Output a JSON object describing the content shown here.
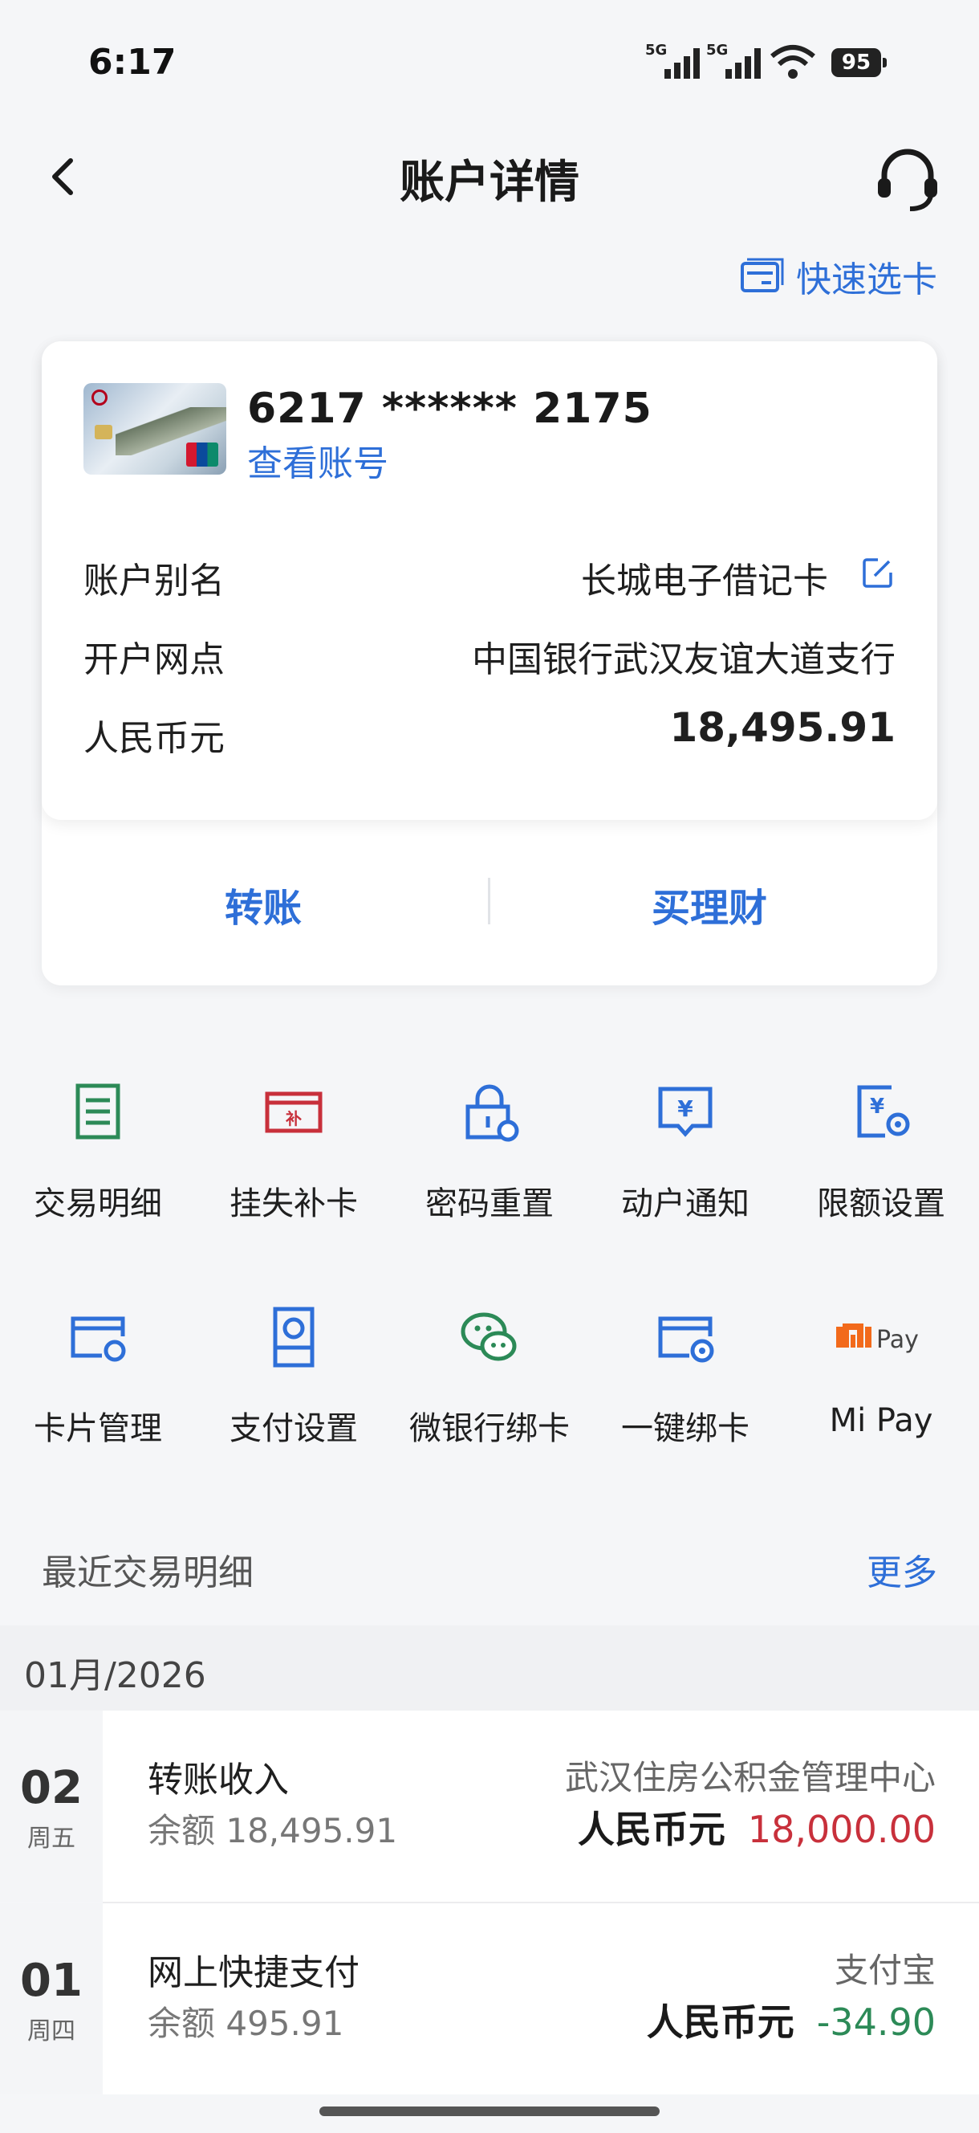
{
  "status_bar": {
    "time": "6:17",
    "battery": "95"
  },
  "header": {
    "title": "账户详情"
  },
  "quick_select": {
    "label": "快速选卡"
  },
  "card": {
    "account_number": "6217 ****** 2175",
    "view_account_label": "查看账号",
    "rows": [
      {
        "label": "账户别名",
        "value": "长城电子借记卡"
      },
      {
        "label": "开户网点",
        "value": "中国银行武汉友谊大道支行"
      },
      {
        "label": "人民币元",
        "value": "18,495.91"
      }
    ],
    "actions": [
      "转账",
      "买理财"
    ]
  },
  "services": [
    {
      "label": "交易明细",
      "icon": "transaction-list-icon"
    },
    {
      "label": "挂失补卡",
      "icon": "report-loss-icon"
    },
    {
      "label": "密码重置",
      "icon": "password-reset-icon"
    },
    {
      "label": "动户通知",
      "icon": "account-notice-icon"
    },
    {
      "label": "限额设置",
      "icon": "limit-settings-icon"
    },
    {
      "label": "卡片管理",
      "icon": "card-management-icon"
    },
    {
      "label": "支付设置",
      "icon": "payment-settings-icon"
    },
    {
      "label": "微银行绑卡",
      "icon": "wechat-bind-icon"
    },
    {
      "label": "一键绑卡",
      "icon": "one-click-bind-icon"
    },
    {
      "label": "Mi Pay",
      "icon": "mi-pay-icon",
      "logo_text": "Pay"
    }
  ],
  "recent": {
    "title": "最近交易明细",
    "more_label": "更多",
    "month": "01月/2026",
    "transactions": [
      {
        "day": "02",
        "weekday": "周五",
        "name": "转账收入",
        "balance": "余额  18,495.91",
        "counterparty": "武汉住房公积金管理中心",
        "currency": "人民币元",
        "amount": "18,000.00",
        "direction": "in"
      },
      {
        "day": "01",
        "weekday": "周四",
        "name": "网上快捷支付",
        "balance": "余额  495.91",
        "counterparty": "支付宝",
        "currency": "人民币元",
        "amount": "-34.90",
        "direction": "out"
      }
    ]
  },
  "colors": {
    "accent": "#2e6fd8",
    "income": "#c8303b",
    "expense": "#2c8a57"
  }
}
